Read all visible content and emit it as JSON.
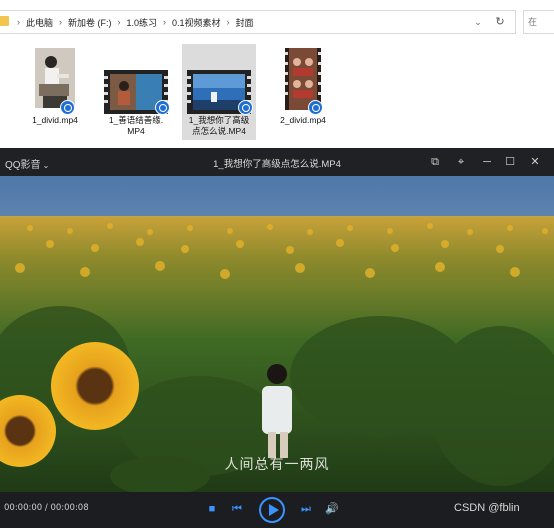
{
  "explorer": {
    "breadcrumbs": [
      "此电脑",
      "新加卷 (F:)",
      "1.0练习",
      "0.1视频素材",
      "封面"
    ],
    "search_placeholder": "在",
    "files": [
      {
        "name_line1": "1_divid.mp4",
        "name_line2": ""
      },
      {
        "name_line1": "1_善语结善缘.",
        "name_line2": "MP4"
      },
      {
        "name_line1": "1_我想你了高级",
        "name_line2": "点怎么说.MP4"
      },
      {
        "name_line1": "2_divid.mp4",
        "name_line2": ""
      }
    ]
  },
  "player": {
    "app_name": "QQ影音",
    "video_title": "1_我想你了高级点怎么说.MP4",
    "subtitle": "人间总有一两风",
    "timecode": "00:00:00 / 00:00:08",
    "watermark": "CSDN @fblin",
    "icons": {
      "window": [
        "pip-icon",
        "pin-icon",
        "minimize-icon",
        "maximize-icon",
        "close-icon"
      ],
      "controls": [
        "stop-icon",
        "prev-icon",
        "play-icon",
        "next-icon",
        "volume-icon"
      ]
    },
    "accent_color": "#3b93ff"
  }
}
